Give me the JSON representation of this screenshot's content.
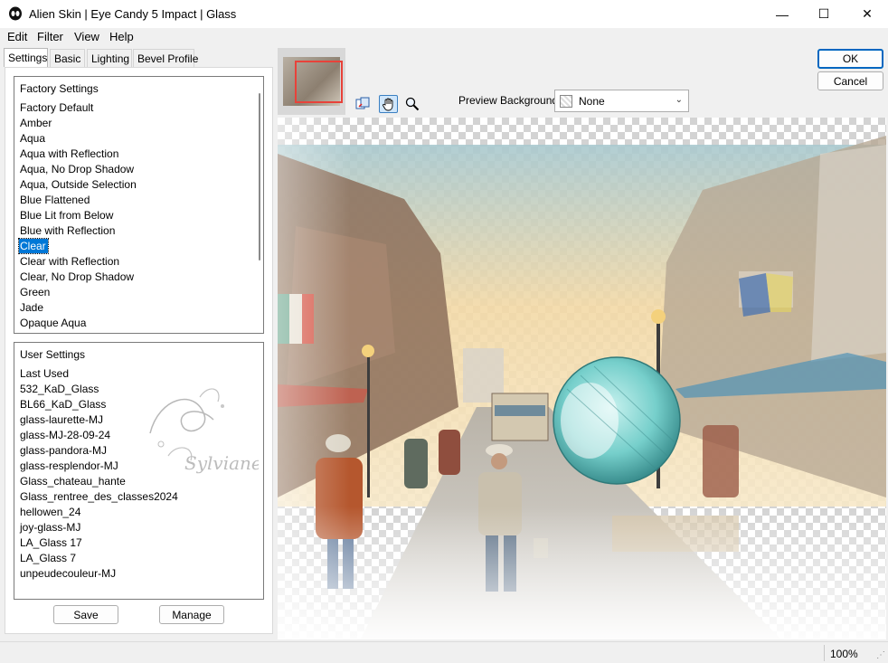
{
  "window": {
    "title": "Alien Skin | Eye Candy 5 Impact | Glass",
    "controls": {
      "minimize": "—",
      "maximize": "☐",
      "close": "✕"
    }
  },
  "menu": [
    "Edit",
    "Filter",
    "View",
    "Help"
  ],
  "tabs": [
    "Settings",
    "Basic",
    "Lighting",
    "Bevel Profile"
  ],
  "factory_settings": {
    "label": "Factory Settings",
    "items": [
      "Factory Default",
      "Amber",
      "Aqua",
      "Aqua with Reflection",
      "Aqua, No Drop Shadow",
      "Aqua, Outside Selection",
      "Blue Flattened",
      "Blue Lit from Below",
      "Blue with Reflection",
      "Clear",
      "Clear with Reflection",
      "Clear, No Drop Shadow",
      "Green",
      "Jade",
      "Opaque Aqua"
    ],
    "selected": "Clear"
  },
  "user_settings": {
    "label": "User Settings",
    "items": [
      "Last Used",
      "532_KaD_Glass",
      "BL66_KaD_Glass",
      "glass-laurette-MJ",
      "glass-MJ-28-09-24",
      "glass-pandora-MJ",
      "glass-resplendor-MJ",
      "Glass_chateau_hante",
      "Glass_rentree_des_classes2024",
      "hellowen_24",
      "joy-glass-MJ",
      "LA_Glass 17",
      "LA_Glass 7",
      "unpeudecouleur-MJ"
    ],
    "watermark": "Sylviane"
  },
  "buttons": {
    "save": "Save",
    "manage": "Manage",
    "ok": "OK",
    "cancel": "Cancel"
  },
  "preview_background": {
    "label": "Preview Background:",
    "value": "None"
  },
  "tools": [
    "compare-icon",
    "hand-icon",
    "zoom-icon"
  ],
  "status": {
    "zoom": "100%"
  },
  "colors": {
    "accent": "#0078d7",
    "selection": "#0078d7"
  }
}
